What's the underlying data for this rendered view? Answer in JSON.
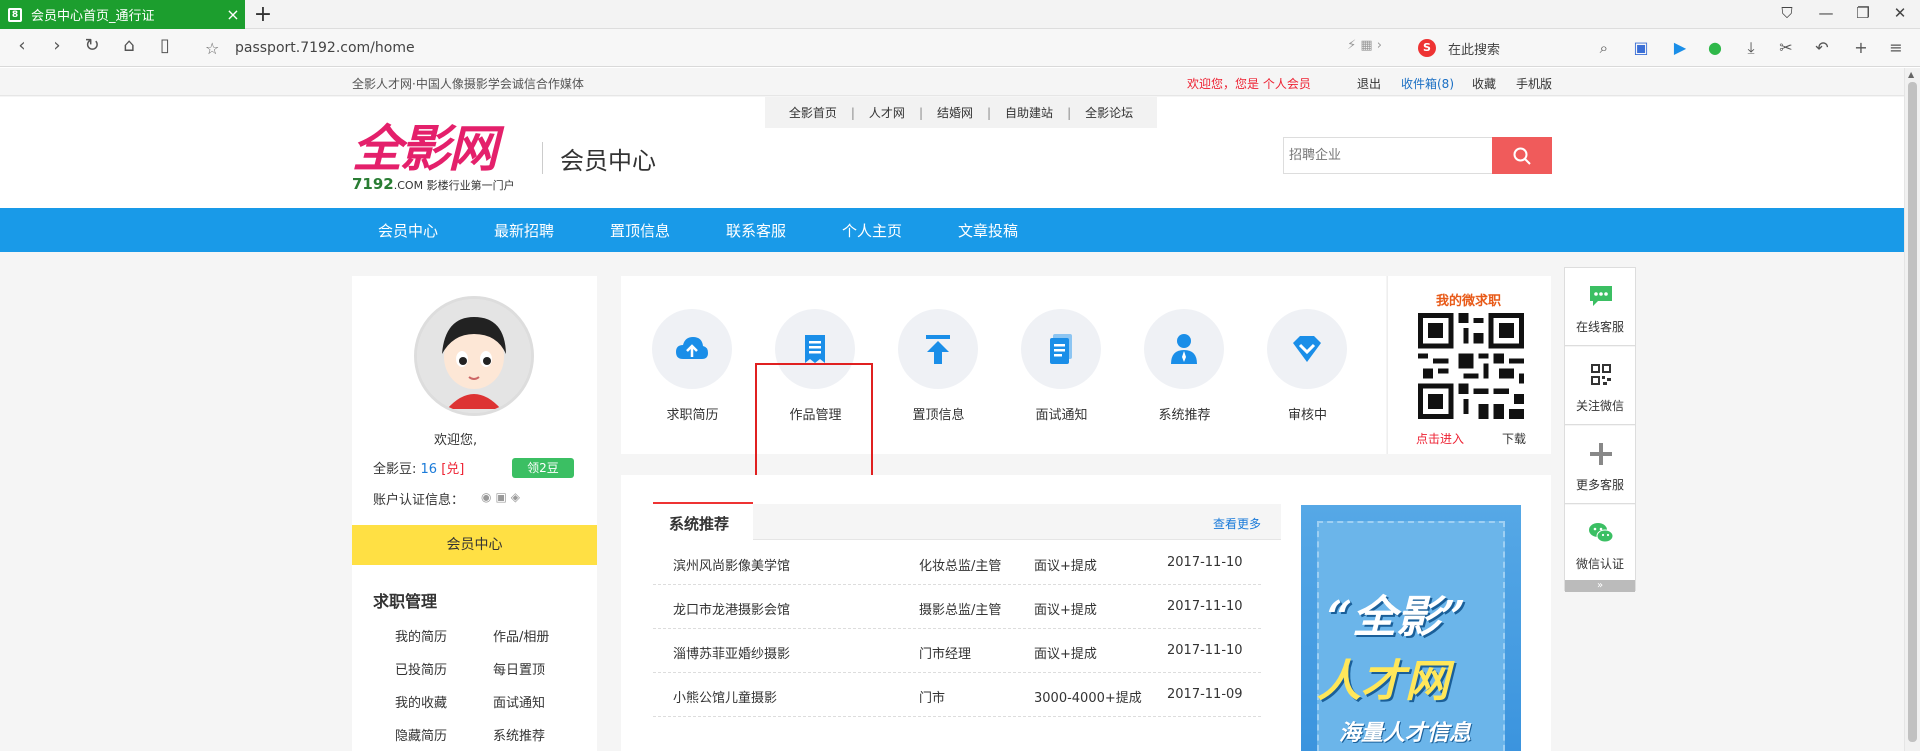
{
  "browser": {
    "tab_title": "会员中心首页_通行证",
    "url": "passport.7192.com/home",
    "search_placeholder": "在此搜索"
  },
  "topbar": {
    "slogan": "全影人才网·中国人像摄影学会诚信合作媒体",
    "welcome": "欢迎您，您是 个人会员",
    "logout": "退出",
    "inbox": "收件箱(8)",
    "favorite": "收藏",
    "mobile": "手机版"
  },
  "subnav": [
    "全影首页",
    "人才网",
    "结婚网",
    "自助建站",
    "全影论坛"
  ],
  "header": {
    "logo_text": "全影网",
    "logo_domain": "7192",
    "logo_dotcom": ".COM",
    "logo_tagline": "影楼行业第一门户",
    "member_title": "会员中心",
    "search_placeholder": "招聘企业"
  },
  "mainnav": [
    "会员中心",
    "最新招聘",
    "置顶信息",
    "联系客服",
    "个人主页",
    "文章投稿"
  ],
  "profile": {
    "welcome": "欢迎您,",
    "beans_label": "全影豆:",
    "beans_value": "16",
    "exchange": "[兑]",
    "get_beans": "领2豆",
    "auth_label": "账户认证信息："
  },
  "left_menu": {
    "member_center": "会员中心",
    "section_title": "求职管理",
    "links": [
      "我的简历",
      "作品/相册",
      "已投简历",
      "每日置顶",
      "我的收藏",
      "面试通知",
      "隐藏简历",
      "系统推荐"
    ]
  },
  "functions": [
    {
      "label": "求职简历",
      "icon": "cloud-upload-icon"
    },
    {
      "label": "作品管理",
      "icon": "document-icon",
      "selected": true
    },
    {
      "label": "置顶信息",
      "icon": "pin-top-icon"
    },
    {
      "label": "面试通知",
      "icon": "notice-icon"
    },
    {
      "label": "系统推荐",
      "icon": "user-icon"
    },
    {
      "label": "审核中",
      "icon": "diamond-icon"
    }
  ],
  "qr": {
    "title": "我的微求职",
    "enter": "点击进入",
    "download": "下载"
  },
  "recommend": {
    "tab": "系统推荐",
    "more": "查看更多",
    "rows": [
      {
        "company": "滨州风尚影像美学馆",
        "position": "化妆总监/主管",
        "salary": "面议+提成",
        "date": "2017-11-10"
      },
      {
        "company": "龙口市龙港摄影会馆",
        "position": "摄影总监/主管",
        "salary": "面议+提成",
        "date": "2017-11-10"
      },
      {
        "company": "淄博苏菲亚婚纱摄影",
        "position": "门市经理",
        "salary": "面议+提成",
        "date": "2017-11-10"
      },
      {
        "company": "小熊公馆儿童摄影",
        "position": "门市",
        "salary": "3000-4000+提成",
        "date": "2017-11-09"
      }
    ]
  },
  "banner": {
    "line1": "“全影”",
    "line2": "人才网",
    "line3": "海量人才信息"
  },
  "float_bar": [
    "在线客服",
    "关注微信",
    "更多客服",
    "微信认证"
  ]
}
